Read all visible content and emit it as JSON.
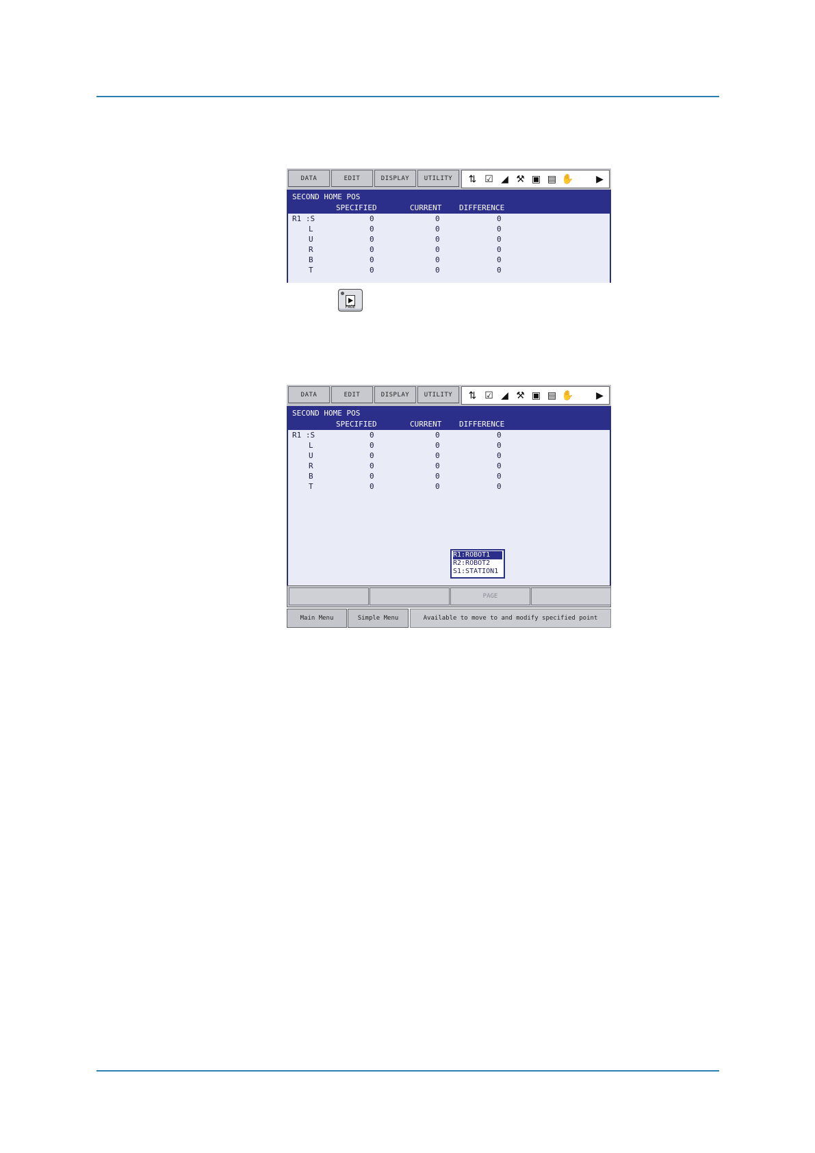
{
  "menu": [
    "DATA",
    "EDIT",
    "DISPLAY",
    "UTILITY"
  ],
  "icons": [
    "coordinate-icon",
    "edit-mode-icon",
    "speed-icon",
    "tool-icon",
    "camera-icon",
    "program-icon",
    "hand-icon",
    "play-icon"
  ],
  "panel": {
    "title": "SECOND HOME POS",
    "columns": [
      "SPECIFIED",
      "CURRENT",
      "DIFFERENCE"
    ],
    "group_label": "R1 :S",
    "rows": [
      {
        "axis": "",
        "specified": "0",
        "current": "0",
        "difference": "0"
      },
      {
        "axis": "L",
        "specified": "0",
        "current": "0",
        "difference": "0"
      },
      {
        "axis": "U",
        "specified": "0",
        "current": "0",
        "difference": "0"
      },
      {
        "axis": "R",
        "specified": "0",
        "current": "0",
        "difference": "0"
      },
      {
        "axis": "B",
        "specified": "0",
        "current": "0",
        "difference": "0"
      },
      {
        "axis": "T",
        "specified": "0",
        "current": "0",
        "difference": "0"
      }
    ]
  },
  "page_key": {
    "label": "PAGE"
  },
  "popup": [
    "R1:ROBOT1",
    "R2:ROBOT2",
    "S1:STATION1"
  ],
  "function_keys": [
    "",
    "",
    "PAGE",
    ""
  ],
  "bottom": {
    "main_menu": "Main Menu",
    "simple_menu": "Simple Menu",
    "message": "Available to move to and modify specified point"
  }
}
